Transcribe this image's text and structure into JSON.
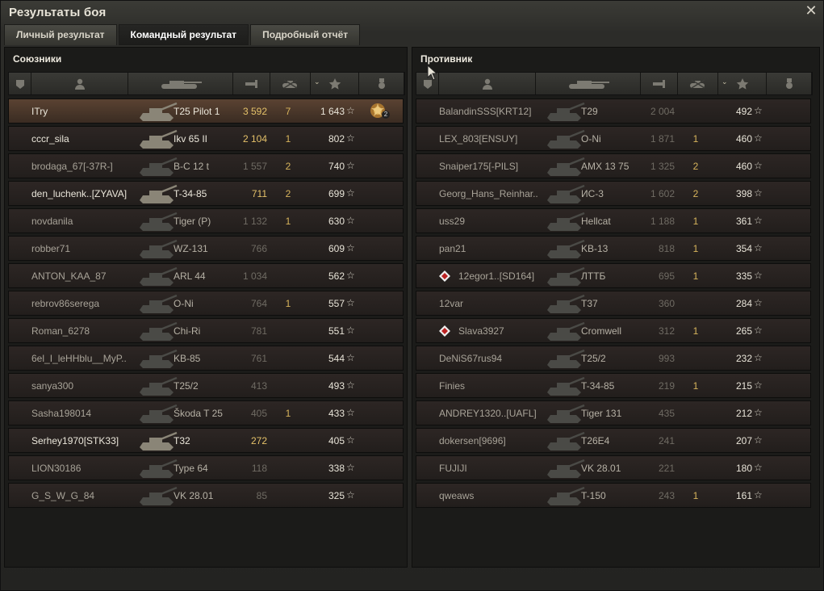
{
  "window": {
    "title": "Результаты боя",
    "close_icon": "close-icon"
  },
  "tabs": [
    {
      "label": "Личный результат",
      "active": false
    },
    {
      "label": "Командный результат",
      "active": true
    },
    {
      "label": "Подробный отчёт",
      "active": false
    }
  ],
  "allies": {
    "title": "Союзники",
    "rows": [
      {
        "name": "ITry",
        "vehicle": "T25 Pilot 1",
        "damage": "3 592",
        "kills": "7",
        "xp": "1 643",
        "highlight": "me",
        "medal_count": "2"
      },
      {
        "name": "cccr_sila",
        "vehicle": "Ikv 65 II",
        "damage": "2 104",
        "kills": "1",
        "xp": "802",
        "highlight": "bright"
      },
      {
        "name": "brodaga_67[-37R-]",
        "vehicle": "B-C 12 t",
        "damage": "1 557",
        "kills": "2",
        "xp": "740",
        "highlight": ""
      },
      {
        "name": "den_luchenk..[ZYAVA]",
        "vehicle": "T-34-85",
        "damage": "711",
        "kills": "2",
        "xp": "699",
        "highlight": "bright"
      },
      {
        "name": "novdanila",
        "vehicle": "Tiger (P)",
        "damage": "1 132",
        "kills": "1",
        "xp": "630",
        "highlight": ""
      },
      {
        "name": "robber71",
        "vehicle": "WZ-131",
        "damage": "766",
        "kills": "",
        "xp": "609",
        "highlight": ""
      },
      {
        "name": "ANTON_KAA_87",
        "vehicle": "ARL 44",
        "damage": "1 034",
        "kills": "",
        "xp": "562",
        "highlight": ""
      },
      {
        "name": "rebrov86serega",
        "vehicle": "O-Ni",
        "damage": "764",
        "kills": "1",
        "xp": "557",
        "highlight": ""
      },
      {
        "name": "Roman_6278",
        "vehicle": "Chi-Ri",
        "damage": "781",
        "kills": "",
        "xp": "551",
        "highlight": ""
      },
      {
        "name": "6el_I_leHHblu__MyP..",
        "vehicle": "KB-85",
        "damage": "761",
        "kills": "",
        "xp": "544",
        "highlight": ""
      },
      {
        "name": "sanya300",
        "vehicle": "T25/2",
        "damage": "413",
        "kills": "",
        "xp": "493",
        "highlight": ""
      },
      {
        "name": "Sasha198014",
        "vehicle": "Škoda T 25",
        "damage": "405",
        "kills": "1",
        "xp": "433",
        "highlight": ""
      },
      {
        "name": "Serhey1970[STK33]",
        "vehicle": "T32",
        "damage": "272",
        "kills": "",
        "xp": "405",
        "highlight": "bright"
      },
      {
        "name": "LION30186",
        "vehicle": "Type 64",
        "damage": "118",
        "kills": "",
        "xp": "338",
        "highlight": ""
      },
      {
        "name": "G_S_W_G_84",
        "vehicle": "VK 28.01",
        "damage": "85",
        "kills": "",
        "xp": "325",
        "highlight": ""
      }
    ]
  },
  "enemies": {
    "title": "Противник",
    "rows": [
      {
        "name": "BalandinSSS[KRT12]",
        "vehicle": "T29",
        "damage": "2 004",
        "kills": "",
        "xp": "492"
      },
      {
        "name": "LEX_803[ENSUY]",
        "vehicle": "O-Ni",
        "damage": "1 871",
        "kills": "1",
        "xp": "460"
      },
      {
        "name": "Snaiper175[-PILS]",
        "vehicle": "AMX 13 75",
        "damage": "1 325",
        "kills": "2",
        "xp": "460"
      },
      {
        "name": "Georg_Hans_Reinhar..",
        "vehicle": "ИС-3",
        "damage": "1 602",
        "kills": "2",
        "xp": "398"
      },
      {
        "name": "uss29",
        "vehicle": "Hellcat",
        "damage": "1 188",
        "kills": "1",
        "xp": "361"
      },
      {
        "name": "pan21",
        "vehicle": "KB-13",
        "damage": "818",
        "kills": "1",
        "xp": "354"
      },
      {
        "name": "12egor1..[SD164]",
        "vehicle": "ЛТТБ",
        "damage": "695",
        "kills": "1",
        "xp": "335",
        "clan_icon": true
      },
      {
        "name": "12var",
        "vehicle": "T37",
        "damage": "360",
        "kills": "",
        "xp": "284"
      },
      {
        "name": "Slava3927",
        "vehicle": "Cromwell",
        "damage": "312",
        "kills": "1",
        "xp": "265",
        "clan_icon": true
      },
      {
        "name": "DeNiS67rus94",
        "vehicle": "T25/2",
        "damage": "993",
        "kills": "",
        "xp": "232"
      },
      {
        "name": "Finies",
        "vehicle": "T-34-85",
        "damage": "219",
        "kills": "1",
        "xp": "215"
      },
      {
        "name": "ANDREY1320..[UAFL]",
        "vehicle": "Tiger 131",
        "damage": "435",
        "kills": "",
        "xp": "212"
      },
      {
        "name": "dokersen[9696]",
        "vehicle": "T26E4",
        "damage": "241",
        "kills": "",
        "xp": "207"
      },
      {
        "name": "FUJIJI",
        "vehicle": "VK 28.01",
        "damage": "221",
        "kills": "",
        "xp": "180"
      },
      {
        "name": "qweaws",
        "vehicle": "T-150",
        "damage": "243",
        "kills": "1",
        "xp": "161"
      }
    ]
  },
  "header_icons": [
    "squad-icon",
    "player-icon",
    "tank-icon",
    "damage-icon",
    "kills-icon",
    "xp-star-icon",
    "medal-icon"
  ],
  "colors": {
    "damage_highlight": "#e4c169",
    "kills": "#d7b45c",
    "self_row": "#5a4232"
  }
}
